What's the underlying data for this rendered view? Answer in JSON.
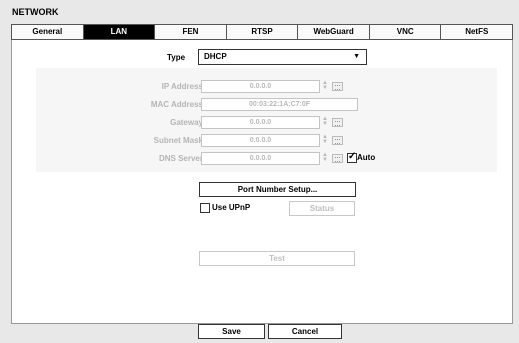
{
  "window": {
    "title": "NETWORK"
  },
  "tabs": [
    {
      "label": "General",
      "active": false
    },
    {
      "label": "LAN",
      "active": true
    },
    {
      "label": "FEN",
      "active": false
    },
    {
      "label": "RTSP",
      "active": false
    },
    {
      "label": "WebGuard",
      "active": false
    },
    {
      "label": "VNC",
      "active": false
    },
    {
      "label": "NetFS",
      "active": false
    }
  ],
  "type": {
    "label": "Type",
    "value": "DHCP"
  },
  "fields": {
    "ip_address": {
      "label": "IP Address",
      "value": "0.0.0.0"
    },
    "mac_address": {
      "label": "MAC Address",
      "value": "00:03:22:1A:C7:0F"
    },
    "gateway": {
      "label": "Gateway",
      "value": "0.0.0.0"
    },
    "subnet_mask": {
      "label": "Subnet Mask",
      "value": "0.0.0.0"
    },
    "dns_server": {
      "label": "DNS Server",
      "value": "0.0.0.0"
    }
  },
  "dns_auto": {
    "label": "Auto",
    "checked": true
  },
  "buttons": {
    "port_setup": "Port Number Setup...",
    "status": "Status",
    "test": "Test",
    "save": "Save",
    "cancel": "Cancel"
  },
  "upnp": {
    "label": "Use UPnP",
    "checked": false
  },
  "colors": {
    "active_tab_bg": "#000000",
    "disabled_text": "#b5b5b5"
  }
}
